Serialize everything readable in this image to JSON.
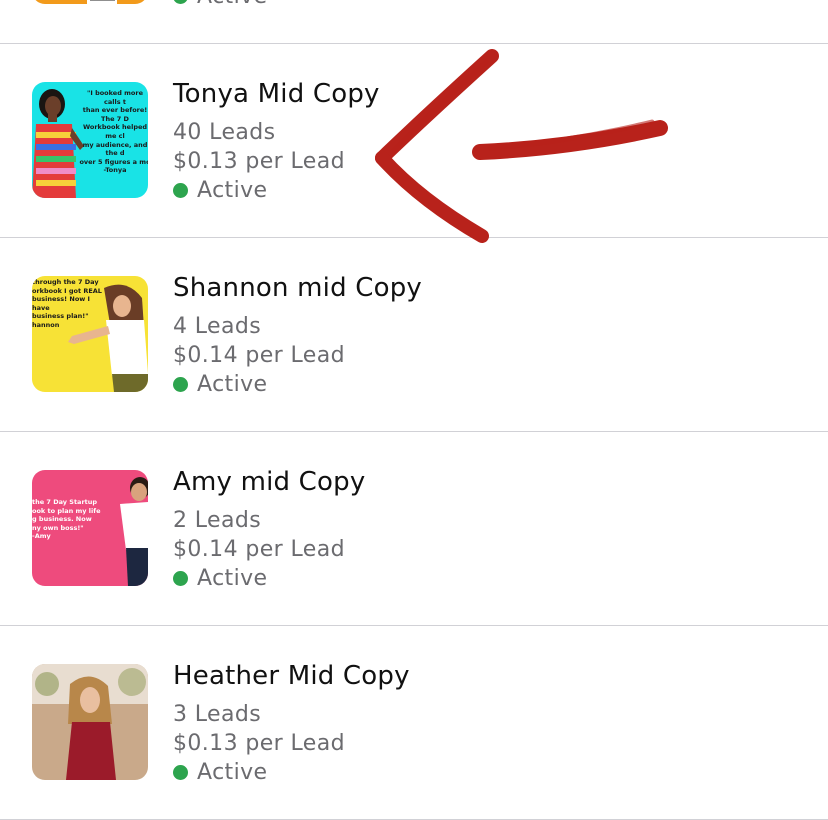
{
  "colors": {
    "active_dot": "#2da44e",
    "divider": "#d1d1d6",
    "annotation_arrow": "#b8221b"
  },
  "annotation": {
    "icon": "hand-drawn-arrow-icon"
  },
  "ads": [
    {
      "name": "",
      "leads": "",
      "cost": "",
      "status": "Active",
      "thumbnail_bg": "#f29a1b",
      "thumbnail_caption": ""
    },
    {
      "name": "Tonya Mid Copy",
      "leads": "40 Leads",
      "cost": "$0.13 per Lead",
      "status": "Active",
      "thumbnail_bg": "#19e3e6",
      "thumbnail_caption": "\"I booked more calls t\nthan ever before! The 7 D\nWorkbook helped me cl\nmy audience, and the d\nover 5 figures a mo\n-Tonya"
    },
    {
      "name": "Shannon mid Copy",
      "leads": "4 Leads",
      "cost": "$0.14 per Lead",
      "status": "Active",
      "thumbnail_bg": "#f7e236",
      "thumbnail_caption": "through the 7 Day\norkbook I got REAL\nbusiness! Now I have\nbusiness plan!\"\nhannon"
    },
    {
      "name": "Amy mid Copy",
      "leads": "2 Leads",
      "cost": "$0.14 per Lead",
      "status": "Active",
      "thumbnail_bg": "#ee4b7d",
      "thumbnail_caption": "the 7 Day Startup\nook to plan my life\ng business. Now\nny own boss!\"\n-Amy"
    },
    {
      "name": "Heather Mid Copy",
      "leads": "3 Leads",
      "cost": "$0.13 per Lead",
      "status": "Active",
      "thumbnail_bg": "#c9a98a",
      "thumbnail_caption": ""
    }
  ]
}
